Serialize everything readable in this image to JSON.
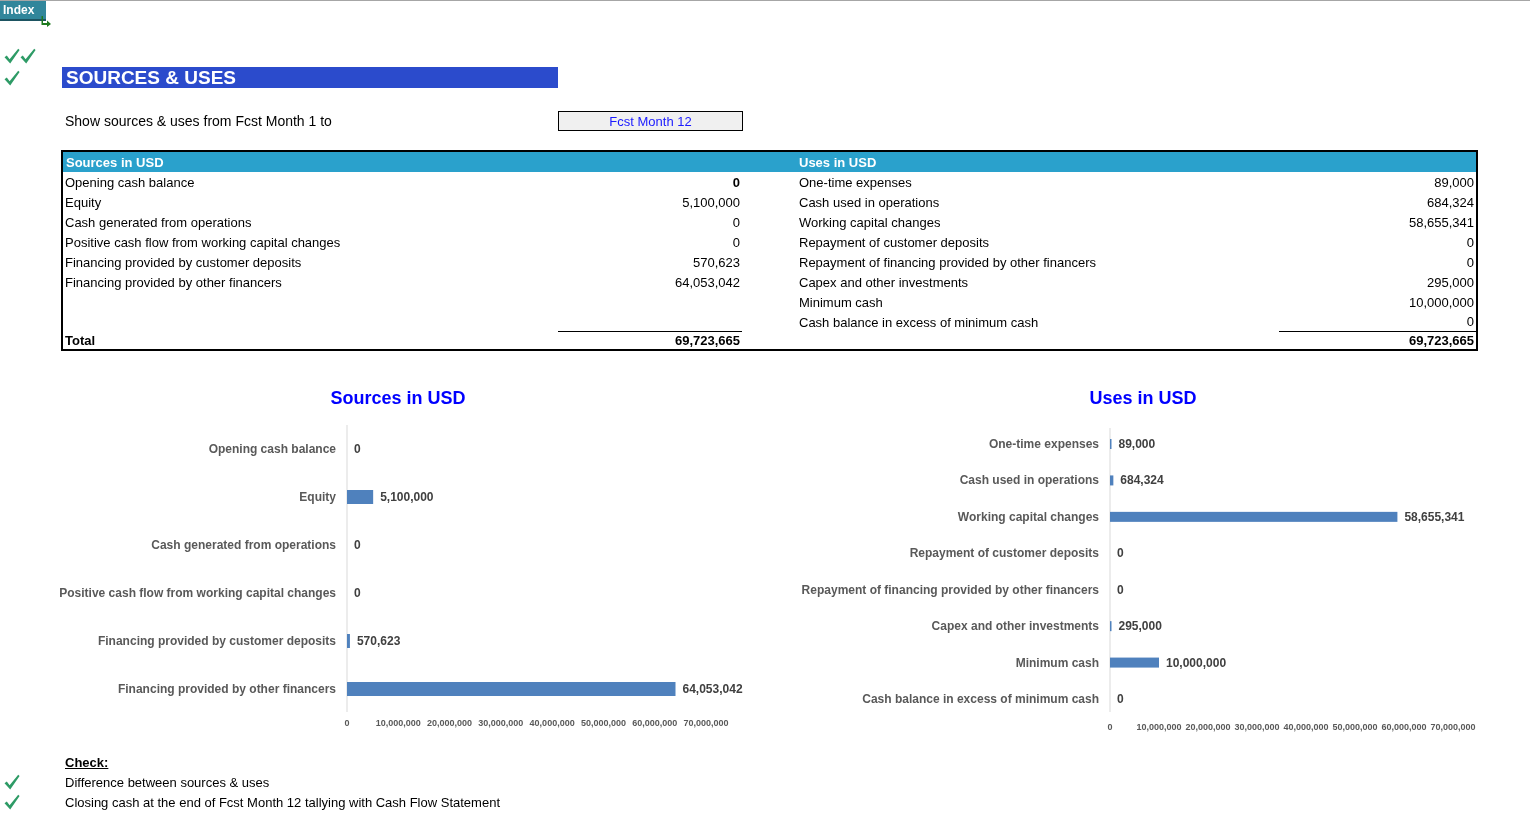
{
  "index_button": {
    "label": "Index"
  },
  "status_marks": [
    {
      "marks": [
        {
          "ok": true
        },
        {
          "ok": true
        }
      ]
    },
    {
      "marks": [
        {
          "ok": true
        }
      ]
    }
  ],
  "title": "SOURCES & USES",
  "period": {
    "label": "Show sources & uses from Fcst Month 1 to",
    "value": "Fcst Month 12"
  },
  "table": {
    "sources": {
      "heading": "Sources in USD",
      "rows": [
        {
          "label": "Opening cash balance",
          "value": "0",
          "bold": true
        },
        {
          "label": "Equity",
          "value": "5,100,000",
          "bold": false
        },
        {
          "label": "Cash generated from operations",
          "value": "0",
          "bold": false
        },
        {
          "label": "Positive cash flow from working capital changes",
          "value": "0",
          "bold": false
        },
        {
          "label": "Financing provided by customer deposits",
          "value": "570,623",
          "bold": false
        },
        {
          "label": "Financing provided by other financers",
          "value": "64,053,042",
          "bold": false
        }
      ],
      "total_label": "Total",
      "total": "69,723,665"
    },
    "uses": {
      "heading": "Uses in USD",
      "rows": [
        {
          "label": "One-time expenses",
          "value": "89,000"
        },
        {
          "label": "Cash used in operations",
          "value": "684,324"
        },
        {
          "label": "Working capital changes",
          "value": "58,655,341"
        },
        {
          "label": "Repayment of customer deposits",
          "value": "0"
        },
        {
          "label": "Repayment of financing provided by other financers",
          "value": "0"
        },
        {
          "label": "Capex and other investments",
          "value": "295,000"
        },
        {
          "label": "Minimum cash",
          "value": "10,000,000"
        },
        {
          "label": "Cash balance in excess of minimum cash",
          "value": "0"
        }
      ],
      "total": "69,723,665"
    }
  },
  "charts": [
    {
      "chart_data": {
        "type": "bar",
        "orientation": "horizontal",
        "title": "Sources in USD",
        "categories": [
          "Opening cash balance",
          "Equity",
          "Cash generated from operations",
          "Positive cash flow from working capital changes",
          "Financing provided by customer deposits",
          "Financing provided by other financers"
        ],
        "series": [
          {
            "color": "#4f81bd",
            "values": [
              0,
              5100000,
              0,
              0,
              570623,
              64053042
            ]
          }
        ],
        "xlim": [
          0,
          70000000
        ],
        "xticks": [
          0,
          {
            "value": 10000000,
            "label": "10,000,000"
          },
          {
            "value": 20000000,
            "label": "20,000,000"
          },
          {
            "value": 30000000,
            "label": "30,000,000"
          },
          {
            "value": 40000000,
            "label": "40,000,000"
          },
          {
            "value": 50000000,
            "label": "50,000,000"
          },
          {
            "value": 60000000,
            "label": "60,000,000"
          },
          {
            "value": 70000000,
            "label": "70,000,000"
          }
        ],
        "value_labels": [
          "0",
          "5,100,000",
          "0",
          "0",
          "570,623",
          "64,053,042"
        ]
      }
    },
    {
      "chart_data": {
        "type": "bar",
        "orientation": "horizontal",
        "title": "Uses in USD",
        "categories": [
          "One-time expenses",
          "Cash used in operations",
          "Working capital changes",
          "Repayment of customer deposits",
          "Repayment of financing provided by other financers",
          "Capex and other investments",
          "Minimum cash",
          "Cash balance in excess of minimum cash"
        ],
        "series": [
          {
            "color": "#4f81bd",
            "values": [
              89000,
              684324,
              58655341,
              0,
              0,
              295000,
              10000000,
              0
            ]
          }
        ],
        "xlim": [
          0,
          70000000
        ],
        "xticks": [
          0,
          {
            "value": 10000000,
            "label": "10,000,000"
          },
          {
            "value": 20000000,
            "label": "20,000,000"
          },
          {
            "value": 30000000,
            "label": "30,000,000"
          },
          {
            "value": 40000000,
            "label": "40,000,000"
          },
          {
            "value": 50000000,
            "label": "50,000,000"
          },
          {
            "value": 60000000,
            "label": "60,000,000"
          },
          {
            "value": 70000000,
            "label": "70,000,000"
          }
        ],
        "value_labels": [
          "89,000",
          "684,324",
          "58,655,341",
          "0",
          "0",
          "295,000",
          "10,000,000",
          "0"
        ]
      }
    }
  ],
  "checks": {
    "heading": "Check:",
    "items": [
      {
        "label": "Difference between sources & uses",
        "ok": true
      },
      {
        "label": "Closing cash at the end of Fcst Month 12 tallying with Cash Flow Statement",
        "ok": true
      }
    ]
  }
}
